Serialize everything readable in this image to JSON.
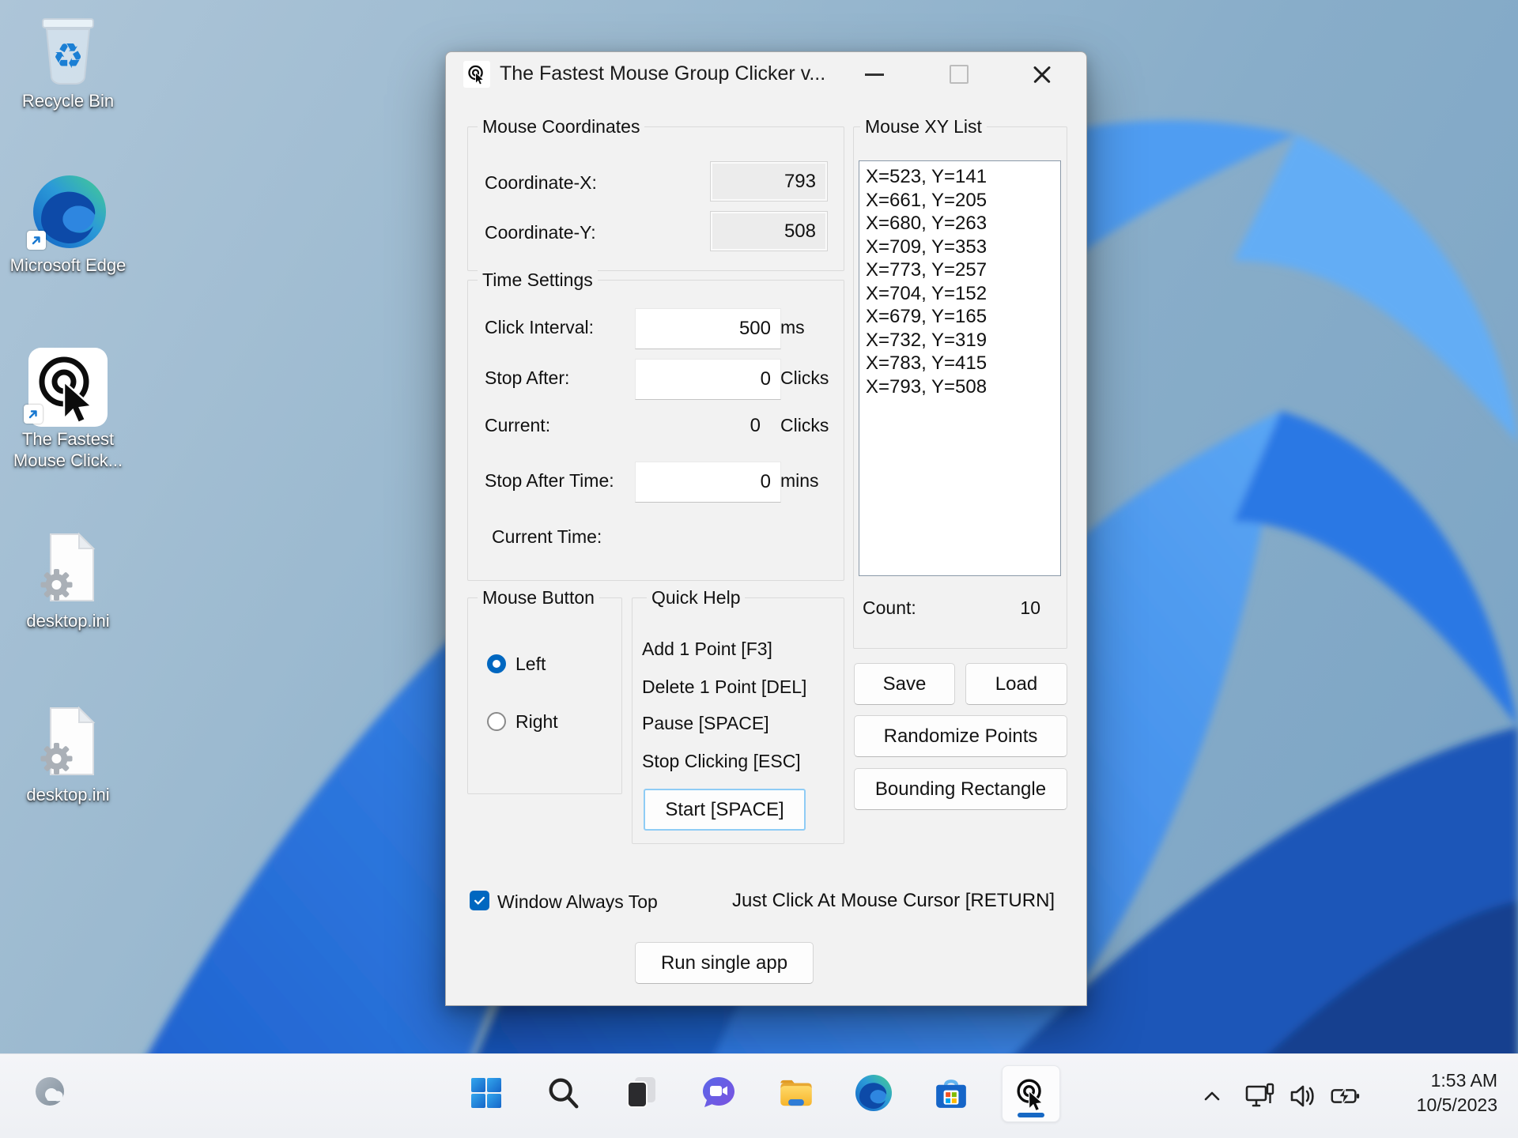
{
  "colors": {
    "accent_blue": "#0067c0",
    "window_bg": "#f2f2f2",
    "taskbar_bg": "#f1f2f6",
    "start_button_border": "#8fccf5",
    "selection_blue": "#1668c4"
  },
  "icons": {
    "app-logo-icon": "click-circle-with-cursor",
    "recycle-bin-icon": "transparent-bin-recycle-arrows",
    "edge-icon": "blue-green-swirl",
    "ini-file-icon": "document-with-gear",
    "shortcut-arrow-icon": "blue-arrow-up-right",
    "start-icon": "windows-four-squares",
    "search-icon": "magnifier",
    "task-view-icon": "overlapping-windows",
    "chat-icon": "video-chat-bubble",
    "file-explorer-icon": "yellow-folder",
    "store-icon": "shopping-bag-grid",
    "widgets-icon": "gray-circle-cloud",
    "chevron-up-icon": "caret-up",
    "network-icon": "display-with-cable",
    "volume-icon": "speaker-waves",
    "battery-icon": "battery-charging"
  },
  "desktop": {
    "icons": [
      {
        "label": "Recycle Bin"
      },
      {
        "label": "Microsoft Edge"
      },
      {
        "label": "The Fastest Mouse Click..."
      },
      {
        "label": "desktop.ini"
      },
      {
        "label": "desktop.ini"
      }
    ]
  },
  "window": {
    "title": "The Fastest Mouse Group Clicker v...",
    "mouse_coordinates": {
      "group_label": "Mouse Coordinates",
      "coordinate_x_label": "Coordinate-X:",
      "coordinate_x_value": "793",
      "coordinate_y_label": "Coordinate-Y:",
      "coordinate_y_value": "508"
    },
    "time_settings": {
      "group_label": "Time Settings",
      "click_interval_label": "Click Interval:",
      "click_interval_value": "500",
      "click_interval_unit": "ms",
      "stop_after_label": "Stop After:",
      "stop_after_value": "0",
      "stop_after_unit": "Clicks",
      "current_label": "Current:",
      "current_value": "0",
      "current_unit": "Clicks",
      "stop_after_time_label": "Stop After Time:",
      "stop_after_time_value": "0",
      "stop_after_time_unit": "mins",
      "current_time_label": "Current Time:",
      "current_time_value": ""
    },
    "mouse_button": {
      "group_label": "Mouse Button",
      "left_label": "Left",
      "left_selected": true,
      "right_label": "Right",
      "right_selected": false
    },
    "quick_help": {
      "group_label": "Quick Help",
      "lines": [
        "Add 1 Point [F3]",
        "Delete 1 Point [DEL]",
        "Pause [SPACE]",
        "Stop Clicking [ESC]"
      ],
      "start_button_label": "Start [SPACE]"
    },
    "xy_list": {
      "group_label": "Mouse XY List",
      "items": [
        "X=523, Y=141",
        "X=661, Y=205",
        "X=680, Y=263",
        "X=709, Y=353",
        "X=773, Y=257",
        "X=704, Y=152",
        "X=679, Y=165",
        "X=732, Y=319",
        "X=783, Y=415",
        "X=793, Y=508"
      ],
      "count_label": "Count:",
      "count_value": "10"
    },
    "buttons": {
      "save": "Save",
      "load": "Load",
      "randomize": "Randomize Points",
      "bounding": "Bounding Rectangle"
    },
    "footer": {
      "always_top_label": "Window Always Top",
      "always_top_checked": true,
      "cursor_hint": "Just Click At Mouse Cursor [RETURN]",
      "run_single_app_label": "Run single app"
    }
  },
  "taskbar": {
    "tray_time": "1:53 AM",
    "tray_date": "10/5/2023"
  }
}
